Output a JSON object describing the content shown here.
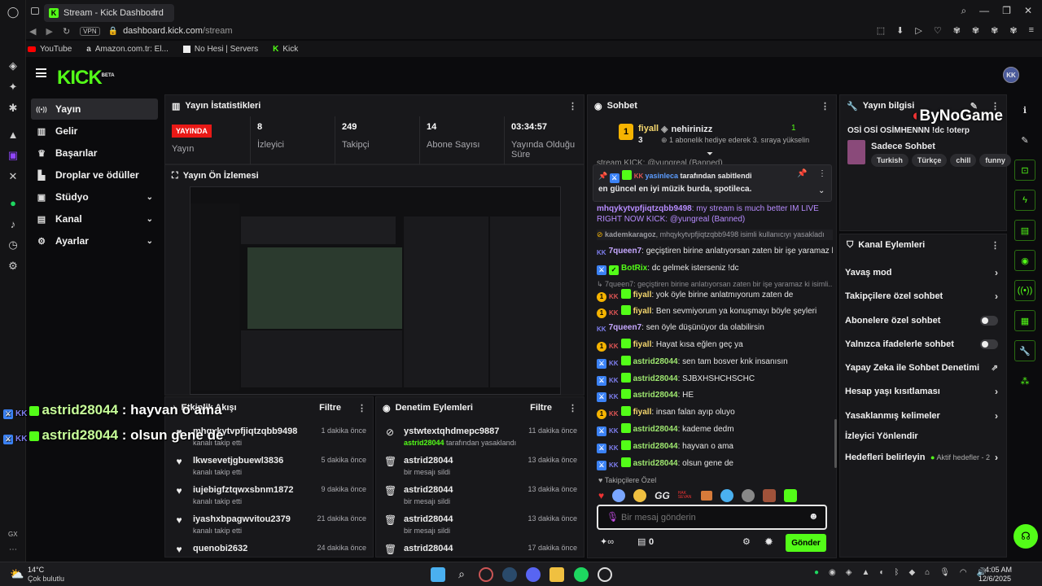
{
  "browser": {
    "tab_title": "Stream - Kick Dashboard",
    "vpn": "VPN",
    "url_host": "dashboard.kick.com",
    "url_path": "/stream",
    "bookmarks": [
      "YouTube",
      "Amazon.com.tr: El...",
      "No Hesi | Servers",
      "Kick"
    ],
    "side_label": "GX"
  },
  "header": {
    "logo": "KICK",
    "logo_sup": "BETA"
  },
  "sidebar": {
    "items": [
      {
        "label": "Yayın",
        "icon": "broadcast-icon",
        "glyph": "((•))"
      },
      {
        "label": "Gelir",
        "icon": "chart-icon",
        "glyph": "▥"
      },
      {
        "label": "Başarılar",
        "icon": "trophy-icon",
        "glyph": "🏆"
      },
      {
        "label": "Droplar ve ödüller",
        "icon": "gift-icon",
        "glyph": "▙"
      },
      {
        "label": "Stüdyo",
        "icon": "studio-icon",
        "glyph": "▣"
      },
      {
        "label": "Kanal",
        "icon": "channel-icon",
        "glyph": "▤"
      },
      {
        "label": "Ayarlar",
        "icon": "gear-icon",
        "glyph": "⚙"
      }
    ]
  },
  "stats": {
    "title": "Yayın İstatistikleri",
    "live": "YAYINDA",
    "live_label": "Yayın",
    "items": [
      {
        "value": "8",
        "label": "İzleyici"
      },
      {
        "value": "249",
        "label": "Takipçi"
      },
      {
        "value": "14",
        "label": "Abone Sayısı"
      },
      {
        "value": "03:34:57",
        "label": "Yayında Olduğu Süre"
      }
    ]
  },
  "preview": {
    "title": "Yayın Ön İzlemesi"
  },
  "overlay": {
    "lines": [
      {
        "user": "astrid28044",
        "text": " : hayvan o ama"
      },
      {
        "user": "astrid28044",
        "text": " : olsun gene de"
      }
    ]
  },
  "activity": {
    "title": "Etkinlik Akışı",
    "filter": "Filtre",
    "rows": [
      {
        "name": "mhqykytvpfjiqtzqbb9498",
        "sub": "kanalı takip etti",
        "time": "1 dakika önce"
      },
      {
        "name": "lkwsevetjgbuewl3836",
        "sub": "kanalı takip etti",
        "time": "5 dakika önce"
      },
      {
        "name": "iujebigfztqwxsbnm1872",
        "sub": "kanalı takip etti",
        "time": "9 dakika önce"
      },
      {
        "name": "iyashxbpagwvitou2379",
        "sub": "kanalı takip etti",
        "time": "21 dakika önce"
      },
      {
        "name": "quenobi2632",
        "sub": "",
        "time": "24 dakika önce"
      }
    ]
  },
  "moderation": {
    "title": "Denetim Eylemleri",
    "filter": "Filtre",
    "rows": [
      {
        "name": "ystwtextqhdmepc9887",
        "by": "astrid28044",
        "sub": " tarafından yasaklandı",
        "time": "11 dakika önce",
        "icon": "ban-icon"
      },
      {
        "name": "astrid28044",
        "by": "",
        "sub": "bir mesajı sildi",
        "time": "13 dakika önce",
        "icon": "trash-icon"
      },
      {
        "name": "astrid28044",
        "by": "",
        "sub": "bir mesajı sildi",
        "time": "13 dakika önce",
        "icon": "trash-icon"
      },
      {
        "name": "astrid28044",
        "by": "",
        "sub": "bir mesajı sildi",
        "time": "13 dakika önce",
        "icon": "trash-icon"
      },
      {
        "name": "astrid28044",
        "by": "",
        "sub": "",
        "time": "17 dakika önce",
        "icon": "trash-icon"
      }
    ]
  },
  "chat": {
    "title": "Sohbet",
    "top_gifter": {
      "rank": "1",
      "name": "fiyall",
      "count": "3",
      "recipient": "nehirinizz",
      "recipient_count": "1",
      "text": "1 abonelik hediye ederek 3. sıraya yükselin"
    },
    "partial": "stream KICK: @yungreal (Banned)",
    "pinned": {
      "by": "yasinleca",
      "by_suffix": " tarafından sabitlendi",
      "text": "en güncel en iyi müzik burda, spotileca."
    },
    "messages": [
      {
        "user": "mhqykytvpfjiqtzqbb9498",
        "text": ": my stream is much better IM LIVE",
        "color": "#b78cff",
        "style": "banned-name"
      },
      {
        "user": "",
        "text": "RIGHT NOW KICK: @yungreal (Banned)",
        "color": "#b78cff",
        "style": "cont"
      },
      {
        "user": "kademkaragoz",
        "text": ", mhqykytvpfjiqtzqbb9498 isimli kullanıcıyı yasakladı",
        "color": "#9a9aa0",
        "style": "system"
      },
      {
        "user": "7queen7",
        "text": ": geçiştiren birine anlatıyorsan zaten bir işe yaramaz ki",
        "color": "#c6a8ff",
        "style": "kk"
      },
      {
        "user": "BotRix",
        "text": ": dc gelmek isterseniz !dc",
        "color": "#53fc18",
        "style": "bot"
      },
      {
        "user": "7queen7",
        "text": ": geçiştiren birine anlatıyorsan zaten bir işe yaramaz ki isimli...",
        "color": "#8a8a8f",
        "style": "reply"
      },
      {
        "user": "fiyall",
        "text": ": yok öyle birine anlatmıyorum zaten de",
        "color": "#f5d76e",
        "style": "gold"
      },
      {
        "user": "fiyall",
        "text": ": Ben sevmiyorum ya konuşmayı böyle şeyleri",
        "color": "#f5d76e",
        "style": "gold"
      },
      {
        "user": "7queen7",
        "text": ": sen öyle düşünüyor da olabilirsin",
        "color": "#c6a8ff",
        "style": "kk"
      },
      {
        "user": "fiyall",
        "text": ": Hayat kısa eğlen geç ya",
        "color": "#f5d76e",
        "style": "gold"
      },
      {
        "user": "astrid28044",
        "text": ": sen tam bosver knk insanısın",
        "color": "#9fe870",
        "style": "mod"
      },
      {
        "user": "astrid28044",
        "text": ": SJBXHSHCHSCHC",
        "color": "#9fe870",
        "style": "mod"
      },
      {
        "user": "astrid28044",
        "text": ": HE",
        "color": "#9fe870",
        "style": "mod"
      },
      {
        "user": "fiyall",
        "text": ": insan falan ayıp oluyo",
        "color": "#f5d76e",
        "style": "gold"
      },
      {
        "user": "astrid28044",
        "text": ": kademe dedm",
        "color": "#9fe870",
        "style": "mod"
      },
      {
        "user": "astrid28044",
        "text": ": hayvan o ama",
        "color": "#9fe870",
        "style": "mod"
      },
      {
        "user": "astrid28044",
        "text": ": olsun gene de",
        "color": "#9fe870",
        "style": "mod"
      }
    ],
    "emote_label": "Takipçilere Özel",
    "input_placeholder": "Bir mesaj gönderin",
    "points": "0",
    "send": "Gönder"
  },
  "stream_info": {
    "title": "Yayın bilgisi",
    "stream_title": "OSİ OSİ OSİMHENNN !dc !oterp",
    "category": "Sadece Sohbet",
    "tags": [
      "Turkish",
      "Türkçe",
      "chill",
      "funny"
    ],
    "watermark": "ByNoGame"
  },
  "channel_actions": {
    "title": "Kanal Eylemleri",
    "rows": [
      {
        "label": "Yavaş mod",
        "kind": "chev"
      },
      {
        "label": "Takipçilere özel sohbet",
        "kind": "chev"
      },
      {
        "label": "Abonelere özel sohbet",
        "kind": "toggle"
      },
      {
        "label": "Yalnızca ifadelerle sohbet",
        "kind": "toggle"
      },
      {
        "label": "Yapay Zeka ile Sohbet Denetimi",
        "kind": "ext"
      },
      {
        "label": "Hesap yaşı kısıtlaması",
        "kind": "chev"
      },
      {
        "label": "Yasaklanmış kelimeler",
        "kind": "chev"
      },
      {
        "label": "İzleyici Yönlendir",
        "kind": "none"
      },
      {
        "label": "Hedefleri belirleyin",
        "kind": "goal",
        "extra": "Aktif hedefler - 2"
      }
    ]
  },
  "taskbar": {
    "weather_temp": "14°C",
    "weather_desc": "Çok bulutlu",
    "time": "4:05 AM",
    "date": "12/6/2025"
  },
  "colors": {
    "kick_green": "#53fc18",
    "live_red": "#e91916",
    "panel": "#18181b"
  }
}
